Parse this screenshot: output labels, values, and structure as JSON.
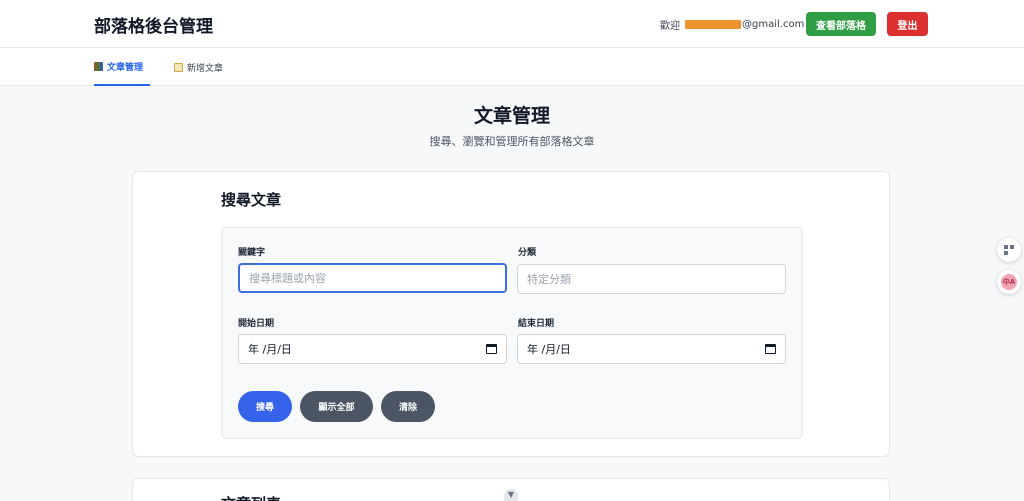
{
  "header": {
    "title": "部落格後台管理",
    "welcome_prefix": "歡迎",
    "email_suffix": "@gmail.com",
    "view_blog_label": "查看部落格",
    "logout_label": "登出"
  },
  "tabs": [
    {
      "label": "文章管理",
      "icon": "books-icon",
      "active": true
    },
    {
      "label": "新增文章",
      "icon": "memo-icon",
      "active": false
    }
  ],
  "page": {
    "title": "文章管理",
    "subtitle": "搜尋、瀏覽和管理所有部落格文章"
  },
  "search": {
    "title": "搜尋文章",
    "keyword_label": "關鍵字",
    "keyword_placeholder": "搜尋標題或內容",
    "category_label": "分類",
    "category_placeholder": "特定分類",
    "start_date_label": "開始日期",
    "start_date_value": "年 /月/日",
    "end_date_label": "結束日期",
    "end_date_value": "年 /月/日",
    "search_button": "搜尋",
    "show_all_button": "顯示全部",
    "clear_button": "清除"
  },
  "list": {
    "title": "文章列表"
  },
  "colors": {
    "primary": "#3563e9",
    "success": "#2f9e44",
    "danger": "#dc2f2f",
    "neutral": "#4b5563"
  }
}
